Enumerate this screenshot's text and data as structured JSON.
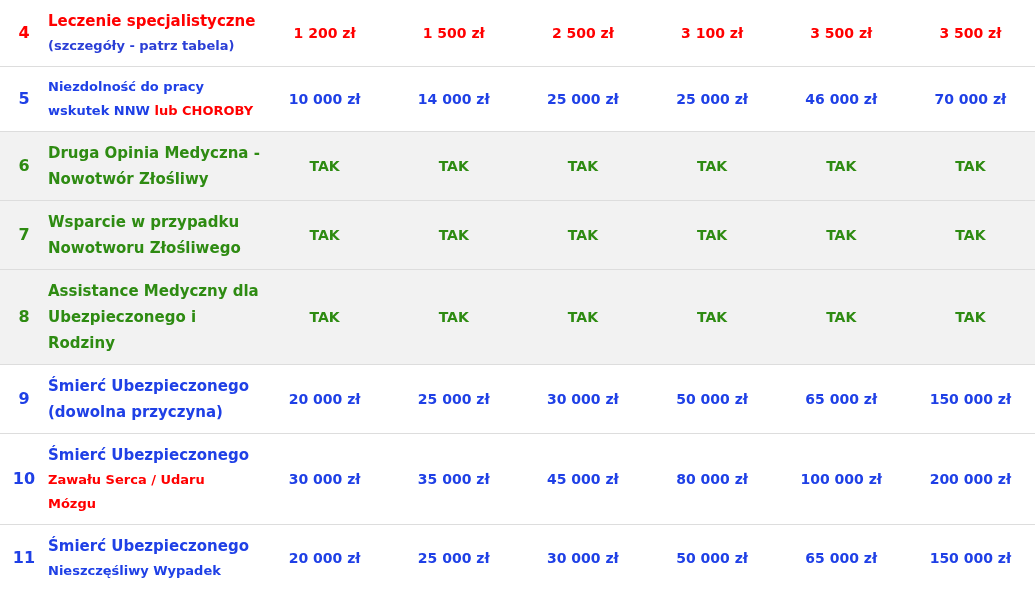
{
  "rows": [
    {
      "number": "4",
      "color": "#ff0000",
      "shaded": false,
      "label": [
        [
          {
            "text": "Leczenie specjalistyczne",
            "color": "#ff0000",
            "kind": "main"
          }
        ],
        [
          {
            "text": "(szczegóły - patrz tabela)",
            "color": "#2b3fd6",
            "kind": "note"
          }
        ]
      ],
      "values": [
        "1 200 zł",
        "1 500 zł",
        "2 500 zł",
        "3 100 zł",
        "3 500 zł",
        "3 500 zł"
      ]
    },
    {
      "number": "5",
      "color": "#1f40e6",
      "shaded": false,
      "label": [
        [
          {
            "text": "Niezdolność do pracy",
            "color": "#1f40e6",
            "kind": "note"
          }
        ],
        [
          {
            "text": "wskutek NNW ",
            "color": "#1f40e6",
            "kind": "note"
          },
          {
            "text": "lub CHOROBY",
            "color": "#ff0000",
            "kind": "note"
          }
        ]
      ],
      "values": [
        "10 000 zł",
        "14 000 zł",
        "25 000 zł",
        "25 000 zł",
        "46 000 zł",
        "70 000 zł"
      ]
    },
    {
      "number": "6",
      "color": "#2e8b12",
      "shaded": true,
      "label": [
        [
          {
            "text": "Druga Opinia Medyczna -",
            "color": "#2e8b12",
            "kind": "main"
          }
        ],
        [
          {
            "text": "Nowotwór Złośliwy",
            "color": "#2e8b12",
            "kind": "main"
          }
        ]
      ],
      "values": [
        "TAK",
        "TAK",
        "TAK",
        "TAK",
        "TAK",
        "TAK"
      ]
    },
    {
      "number": "7",
      "color": "#2e8b12",
      "shaded": true,
      "label": [
        [
          {
            "text": "Wsparcie w przypadku",
            "color": "#2e8b12",
            "kind": "main"
          }
        ],
        [
          {
            "text": "Nowotworu Złośliwego",
            "color": "#2e8b12",
            "kind": "main"
          }
        ]
      ],
      "values": [
        "TAK",
        "TAK",
        "TAK",
        "TAK",
        "TAK",
        "TAK"
      ]
    },
    {
      "number": "8",
      "color": "#2e8b12",
      "shaded": true,
      "label": [
        [
          {
            "text": "Assistance Medyczny dla",
            "color": "#2e8b12",
            "kind": "main"
          }
        ],
        [
          {
            "text": "Ubezpieczonego i",
            "color": "#2e8b12",
            "kind": "main"
          }
        ],
        [
          {
            "text": "Rodziny",
            "color": "#2e8b12",
            "kind": "main"
          }
        ]
      ],
      "values": [
        "TAK",
        "TAK",
        "TAK",
        "TAK",
        "TAK",
        "TAK"
      ]
    },
    {
      "number": "9",
      "color": "#1f40e6",
      "shaded": false,
      "label": [
        [
          {
            "text": "Śmierć Ubezpieczonego",
            "color": "#1f40e6",
            "kind": "main"
          }
        ],
        [
          {
            "text": "(dowolna przyczyna)",
            "color": "#1f40e6",
            "kind": "main"
          }
        ]
      ],
      "values": [
        "20 000 zł",
        "25 000 zł",
        "30 000 zł",
        "50 000 zł",
        "65 000 zł",
        "150 000 zł"
      ]
    },
    {
      "number": "10",
      "color": "#1f40e6",
      "shaded": false,
      "label": [
        [
          {
            "text": "Śmierć Ubezpieczonego",
            "color": "#1f40e6",
            "kind": "main"
          }
        ],
        [
          {
            "text": "Zawału Serca / Udaru",
            "color": "#ff0000",
            "kind": "note"
          }
        ],
        [
          {
            "text": "Mózgu",
            "color": "#ff0000",
            "kind": "note"
          }
        ]
      ],
      "values": [
        "30 000 zł",
        "35 000 zł",
        "45 000 zł",
        "80 000 zł",
        "100 000 zł",
        "200 000 zł"
      ]
    },
    {
      "number": "11",
      "color": "#1f40e6",
      "shaded": false,
      "label": [
        [
          {
            "text": "Śmierć Ubezpieczonego",
            "color": "#1f40e6",
            "kind": "main"
          }
        ],
        [
          {
            "text": "Nieszczęśliwy Wypadek",
            "color": "#1f40e6",
            "kind": "note"
          }
        ]
      ],
      "values": [
        "20 000 zł",
        "25 000 zł",
        "30 000 zł",
        "50 000 zł",
        "65 000 zł",
        "150 000 zł"
      ]
    }
  ]
}
